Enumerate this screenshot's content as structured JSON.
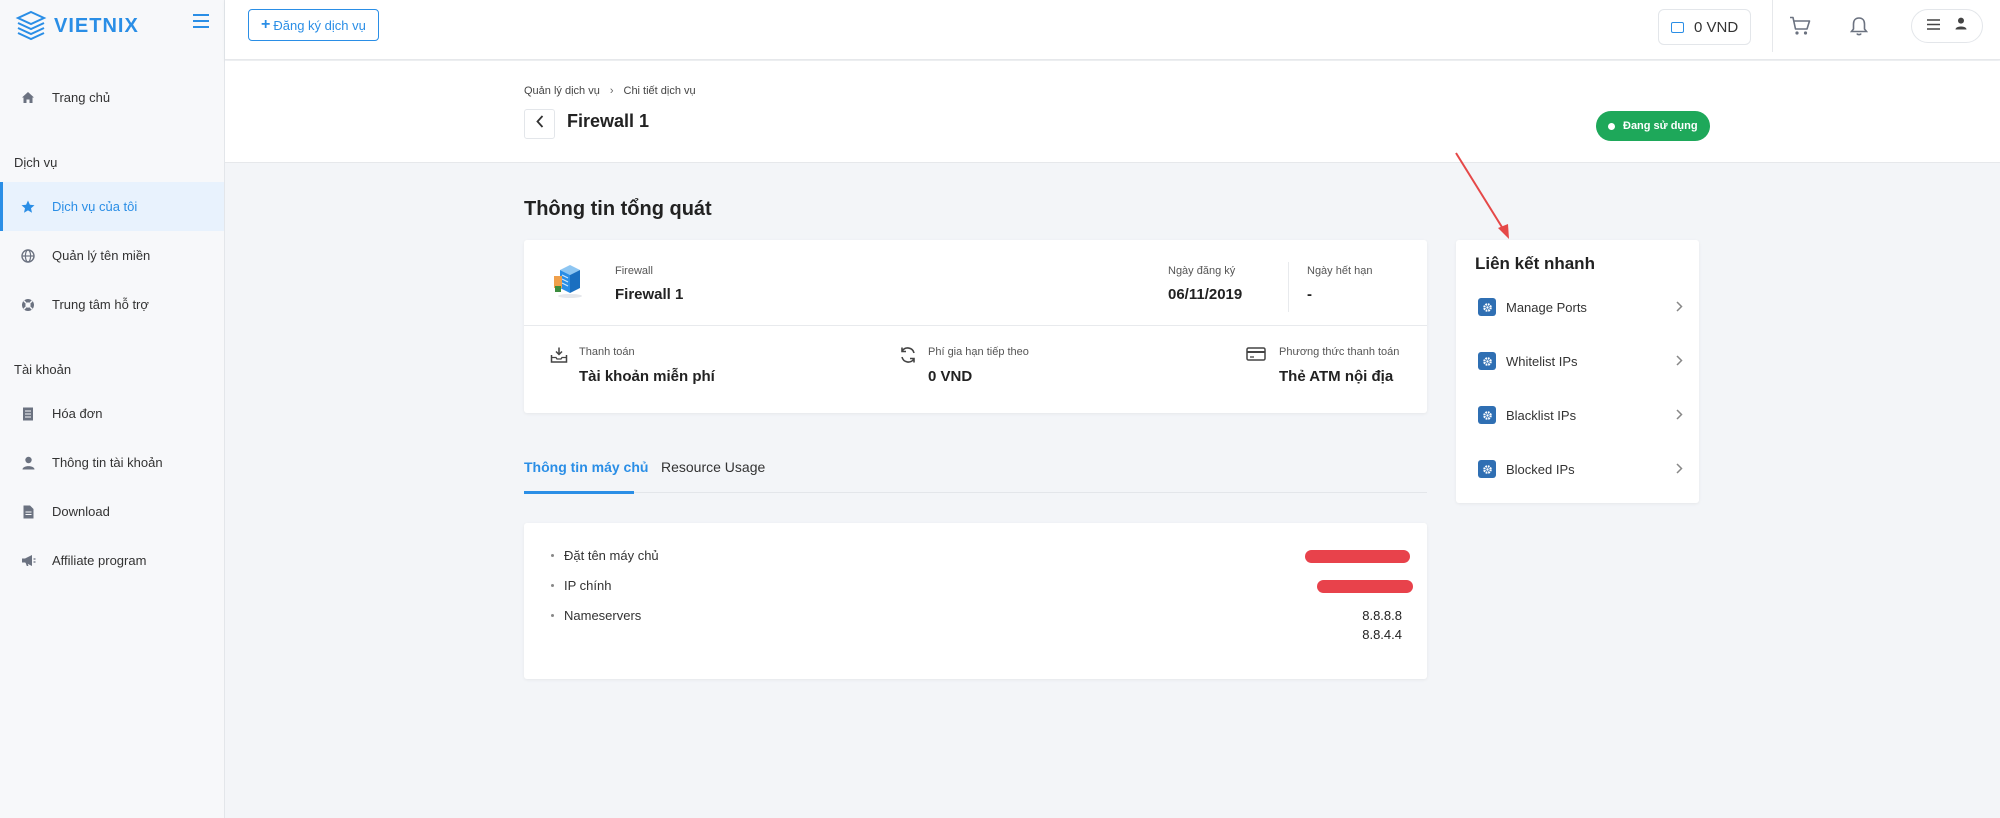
{
  "brand": {
    "name": "VIETNIX"
  },
  "colors": {
    "accent": "#2a8ee6",
    "status_green": "#1ea85a",
    "redaction": "#e8424b"
  },
  "sidebar": {
    "home": {
      "label": "Trang chủ",
      "icon": "home-icon"
    },
    "section_services": "Dịch vụ",
    "services": [
      {
        "label": "Dịch vụ của tôi",
        "icon": "star-icon",
        "active": true
      },
      {
        "label": "Quản lý tên miền",
        "icon": "globe-icon"
      },
      {
        "label": "Trung tâm hỗ trợ",
        "icon": "lifebuoy-icon"
      }
    ],
    "section_account": "Tài khoản",
    "account": [
      {
        "label": "Hóa đơn",
        "icon": "invoice-icon"
      },
      {
        "label": "Thông tin tài khoản",
        "icon": "user-icon"
      },
      {
        "label": "Download",
        "icon": "file-icon"
      },
      {
        "label": "Affiliate program",
        "icon": "megaphone-icon"
      }
    ]
  },
  "topbar": {
    "register_label": "Đăng ký dịch vụ",
    "wallet_balance": "0 VND"
  },
  "header": {
    "breadcrumb": [
      "Quản lý dịch vụ",
      "Chi tiết dịch vụ"
    ],
    "title": "Firewall 1",
    "status": "Đang sử dụng"
  },
  "overview": {
    "section_title": "Thông tin tổng quát",
    "product_type": "Firewall",
    "product_name": "Firewall 1",
    "registered_label": "Ngày đăng ký",
    "registered_value": "06/11/2019",
    "expires_label": "Ngày hết hạn",
    "expires_value": "-",
    "payment_label": "Thanh toán",
    "payment_value": "Tài khoản miễn phí",
    "renewal_label": "Phí gia hạn tiếp theo",
    "renewal_value": "0 VND",
    "method_label": "Phương thức thanh toán",
    "method_value": "Thẻ ATM nội địa"
  },
  "tabs": [
    {
      "label": "Thông tin máy chủ",
      "active": true
    },
    {
      "label": "Resource Usage",
      "active": false
    }
  ],
  "server": {
    "hostname_label": "Đặt tên máy chủ",
    "ip_label": "IP chính",
    "ns_label": "Nameservers",
    "ns_values": [
      "8.8.8.8",
      "8.8.4.4"
    ]
  },
  "quick_links": {
    "title": "Liên kết nhanh",
    "items": [
      "Manage Ports",
      "Whitelist IPs",
      "Blacklist IPs",
      "Blocked IPs"
    ]
  }
}
